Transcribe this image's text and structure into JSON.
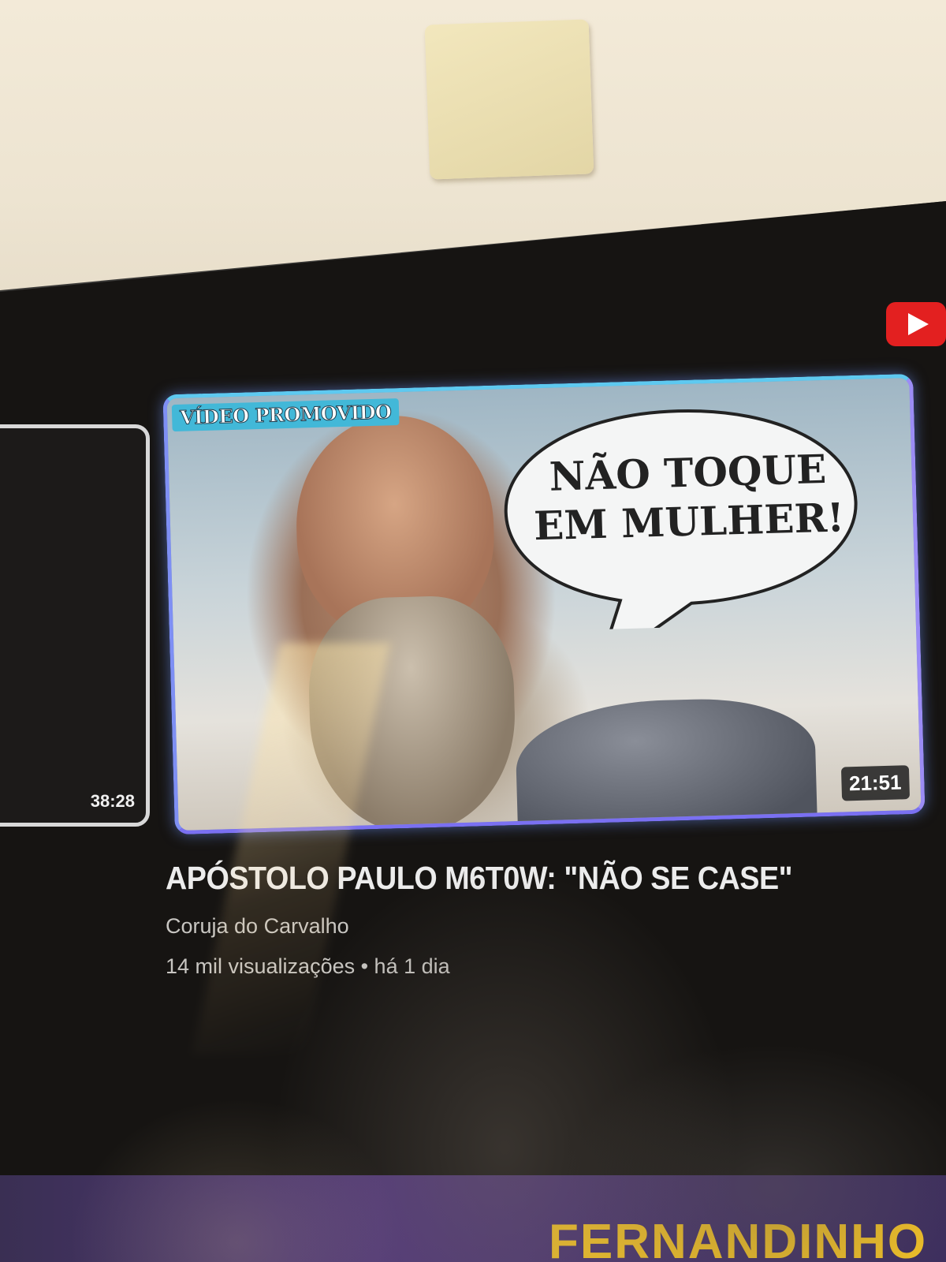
{
  "previous_video": {
    "duration": "38:28"
  },
  "featured_video": {
    "badge": "VÍDEO PROMOVIDO",
    "thumbnail_caption_line1": "NÃO TOQUE",
    "thumbnail_caption_line2": "EM MULHER!",
    "duration": "21:51",
    "title": "APÓSTOLO PAULO M6T0W: \"NÃO SE CASE\"",
    "channel": "Coruja do Carvalho",
    "stats": "14 mil visualizações • há 1 dia"
  },
  "next_row": {
    "partial_title": "FERNANDINHO"
  },
  "icons": {
    "app_logo": "youtube-play-icon"
  },
  "colors": {
    "focus_border": "#7a70f2",
    "badge": "#42b8d8",
    "logo_red": "#e32020",
    "next_title": "#f3c227"
  }
}
